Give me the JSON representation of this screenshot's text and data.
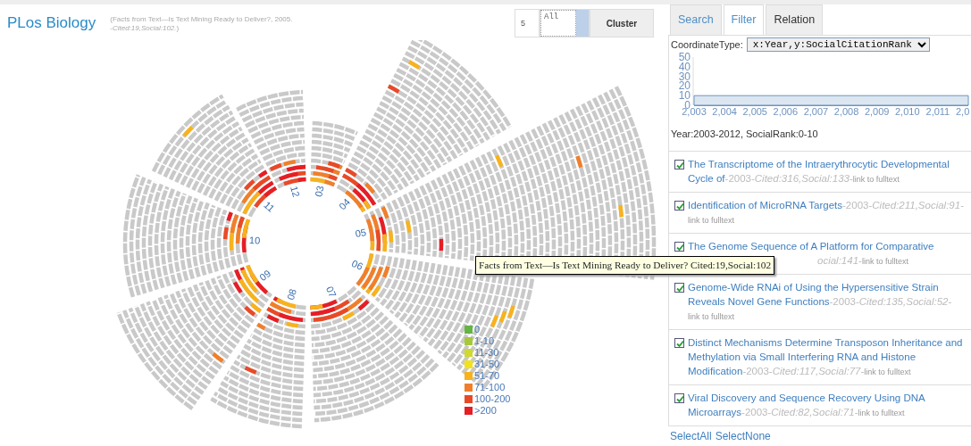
{
  "header": {
    "title": "PLos Biology",
    "subtitle": "(Facts from Text—Is Text Mining Ready to Deliver?, 2005.\n-*Cited:19,Social:102.*)"
  },
  "controls": {
    "count": "5",
    "category": "All",
    "button": "Cluster"
  },
  "wheel": {
    "sectors": [
      {
        "label": "03"
      },
      {
        "label": "04"
      },
      {
        "label": "05"
      },
      {
        "label": "06"
      },
      {
        "label": "07"
      },
      {
        "label": "08"
      },
      {
        "label": "09"
      },
      {
        "label": "10"
      },
      {
        "label": "11"
      },
      {
        "label": "12"
      }
    ]
  },
  "legend": [
    {
      "label": "0",
      "color": "#66b443"
    },
    {
      "label": "1-10",
      "color": "#a6c93a"
    },
    {
      "label": "11-30",
      "color": "#cfd92e"
    },
    {
      "label": "31-50",
      "color": "#f2e21b"
    },
    {
      "label": "51-70",
      "color": "#f7b21e"
    },
    {
      "label": "71-100",
      "color": "#f07f2c"
    },
    {
      "label": "100-200",
      "color": "#e84a28"
    },
    {
      "label": ">200",
      "color": "#e61e26"
    }
  ],
  "tooltip": "Facts from Text—Is Text Mining Ready to Deliver? Cited:19,Social:102",
  "tabs": [
    {
      "label": "Search",
      "selected": false
    },
    {
      "label": "Filter",
      "selected": true
    },
    {
      "label": "Relation",
      "selected": false
    }
  ],
  "filter": {
    "label": "CoordinateType:",
    "value": "x:Year,y:SocialCitationRank",
    "chart_data": {
      "type": "area",
      "x": [
        2003,
        2012
      ],
      "series": [
        {
          "color": "#dce6f1",
          "values": [
            10,
            10
          ]
        }
      ],
      "xlim": [
        2003,
        2012
      ],
      "ylim": [
        0,
        50
      ],
      "yticks": [
        0,
        10,
        20,
        30,
        40,
        50
      ],
      "xticks": [
        {
          "value": 2003,
          "label": "2,003"
        },
        {
          "value": 2004,
          "label": "2,004"
        },
        {
          "value": 2005,
          "label": "2,005"
        },
        {
          "value": 2006,
          "label": "2,006"
        },
        {
          "value": 2007,
          "label": "2,007"
        },
        {
          "value": 2008,
          "label": "2,008"
        },
        {
          "value": 2009,
          "label": "2,009"
        },
        {
          "value": 2010,
          "label": "2,010"
        },
        {
          "value": 2011,
          "label": "2,011"
        }
      ]
    },
    "cut_tick_label": "2,0",
    "summary": "Year:2003-2012, SocialRank:0-10"
  },
  "articles": [
    {
      "checked": true,
      "title": "The Transcriptome of the Intraerythrocytic Developmental Cycle of",
      "meta": "-2003-*Cited:316,Social:133*-",
      "link": "link to fulltext",
      "under_tooltip": false
    },
    {
      "checked": true,
      "title": "Identification of MicroRNA Targets",
      "meta": "-2003-*Cited:211,Social:91*-",
      "link": "link to fulltext",
      "under_tooltip": false
    },
    {
      "checked": true,
      "title": "The Genome Sequence of A Platform for Comparative",
      "meta": "*ocial:141*-",
      "link": "link to fulltext",
      "under_tooltip": true
    },
    {
      "checked": true,
      "title": "Genome-Wide RNAi of Using the Hypersensitive Strain Reveals Novel Gene Functions",
      "meta": "-2003-*Cited:135,Social:52*-",
      "link": "link to fulltext",
      "under_tooltip": false
    },
    {
      "checked": true,
      "title": "Distinct Mechanisms Determine Transposon Inheritance and Methylation via Small Interfering RNA and Histone Modification",
      "meta": "-2003-*Cited:117,Social:77*-",
      "link": "link to fulltext",
      "under_tooltip": false
    },
    {
      "checked": true,
      "title": "Viral Discovery and Sequence Recovery Using DNA Microarrays",
      "meta": "-2003-*Cited:82,Social:71*-",
      "link": "link to fulltext",
      "under_tooltip": false
    }
  ],
  "footer": [
    "SelectAll",
    "SelectNone"
  ]
}
